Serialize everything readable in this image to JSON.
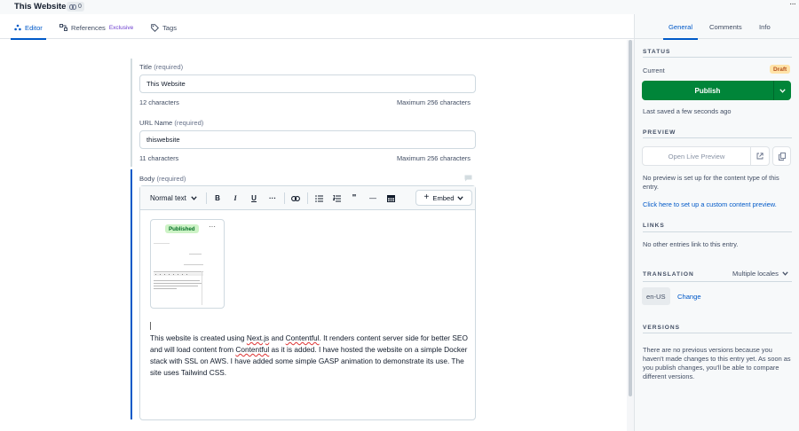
{
  "header": {
    "title": "This Website",
    "link_count": "0"
  },
  "tabs": [
    {
      "label": "Editor"
    },
    {
      "label": "References",
      "badge": "Exclusive"
    },
    {
      "label": "Tags"
    }
  ],
  "fields": {
    "title": {
      "label": "Title",
      "required": "(required)",
      "value": "This Website",
      "count": "12 characters",
      "max": "Maximum 256 characters"
    },
    "url_name": {
      "label": "URL Name",
      "required": "(required)",
      "value": "thiswebsite",
      "count": "11 characters",
      "max": "Maximum 256 characters"
    },
    "body": {
      "label": "Body",
      "required": "(required)"
    }
  },
  "toolbar": {
    "format": "Normal text",
    "bold": "B",
    "italic": "I",
    "underline": "U",
    "more": "···",
    "quote": "\"",
    "hr": "—",
    "embed": "Embed"
  },
  "embedded_card": {
    "status": "Published",
    "more": "···"
  },
  "body_text": {
    "p1": "This website is created using ",
    "w1": "Next.js",
    "p2": " and ",
    "w2": "Contentful",
    "p3": ". It renders content server side for better SEO and will load content from ",
    "w3": "Contentful",
    "p4": " as it is added. I have hosted the website on a simple Docker stack with SSL on AWS. I have added some simple GASP animation to demonstrate its use. The site uses Tailwind CSS."
  },
  "sidebar": {
    "tabs": [
      "General",
      "Comments",
      "Info"
    ],
    "status": {
      "heading": "STATUS",
      "current_label": "Current",
      "badge": "Draft",
      "publish": "Publish",
      "last_saved": "Last saved a few seconds ago"
    },
    "preview": {
      "heading": "PREVIEW",
      "button": "Open Live Preview",
      "note": "No preview is set up for the content type of this entry.",
      "link": "Click here to set up a custom content preview."
    },
    "links": {
      "heading": "LINKS",
      "text": "No other entries link to this entry."
    },
    "translation": {
      "heading": "TRANSLATION",
      "select": "Multiple locales",
      "locale": "en-US",
      "change": "Change"
    },
    "versions": {
      "heading": "VERSIONS",
      "text": "There are no previous versions because you haven't made changes to this entry yet. As soon as you publish changes, you'll be able to compare different versions."
    }
  },
  "colors": {
    "accent": "#0059c8",
    "publish": "#008539",
    "draft_bg": "#ffe3a8",
    "published_bg": "#cdf3c6"
  }
}
